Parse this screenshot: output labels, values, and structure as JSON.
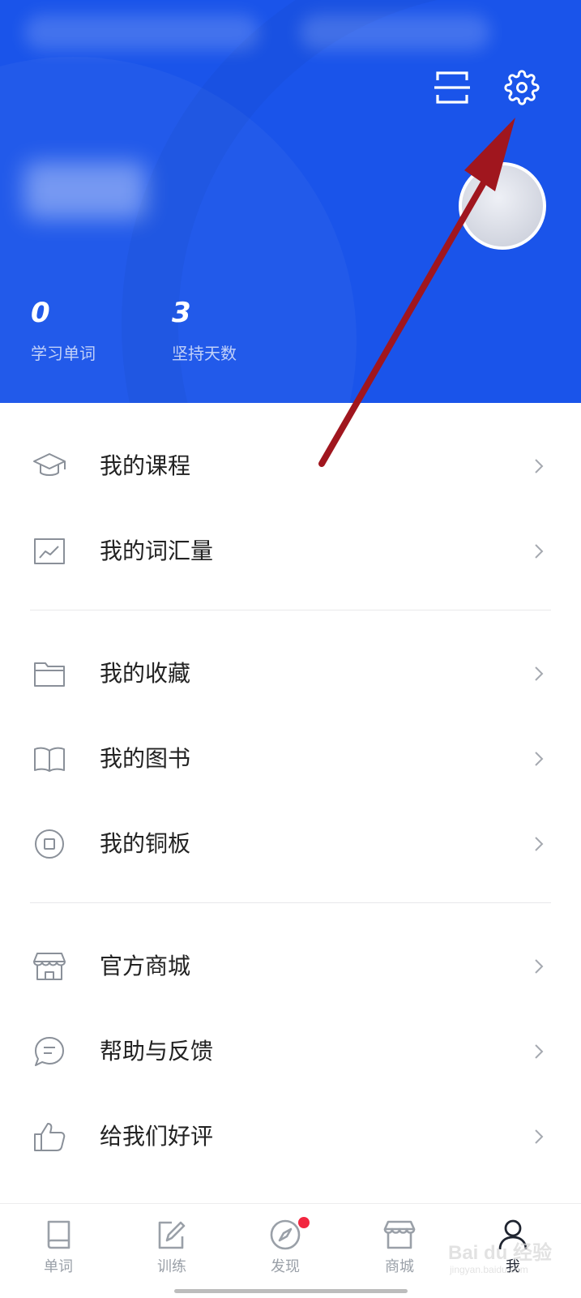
{
  "header": {
    "background_color": "#1a54ea",
    "scan_icon": "scan-icon",
    "settings_icon": "gear-icon"
  },
  "stats": [
    {
      "value": "0",
      "label": "学习单词"
    },
    {
      "value": "3",
      "label": "坚持天数"
    }
  ],
  "menu": [
    {
      "icon": "graduation-cap-icon",
      "label": "我的课程"
    },
    {
      "icon": "chart-frame-icon",
      "label": "我的词汇量"
    },
    {
      "icon": "folder-icon",
      "label": "我的收藏"
    },
    {
      "icon": "open-book-icon",
      "label": "我的图书"
    },
    {
      "icon": "coin-icon",
      "label": "我的铜板"
    },
    {
      "icon": "store-icon",
      "label": "官方商城"
    },
    {
      "icon": "chat-bubble-icon",
      "label": "帮助与反馈"
    },
    {
      "icon": "thumbs-up-icon",
      "label": "给我们好评"
    }
  ],
  "tabs": [
    {
      "label": "单词",
      "icon": "book-icon"
    },
    {
      "label": "训练",
      "icon": "edit-icon"
    },
    {
      "label": "发现",
      "icon": "compass-icon",
      "badge": true
    },
    {
      "label": "商城",
      "icon": "store-icon"
    },
    {
      "label": "我",
      "icon": "person-icon",
      "active": true
    }
  ],
  "colors": {
    "accent": "#1a54ea",
    "badge": "#f2263f",
    "annotation_arrow": "#a0161e"
  },
  "watermark": "jingyan.baidu.com"
}
